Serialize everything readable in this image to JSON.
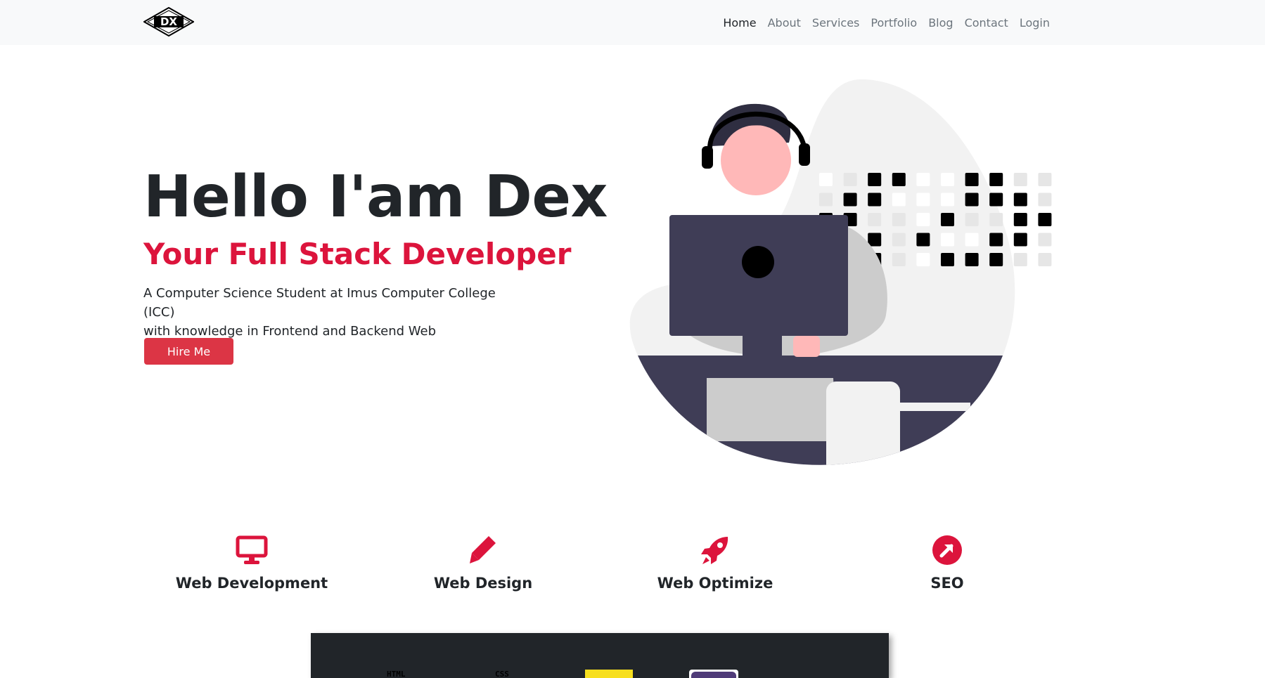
{
  "brand": {
    "logo_text": "DX"
  },
  "nav": {
    "items": [
      {
        "label": "Home",
        "active": true
      },
      {
        "label": "About"
      },
      {
        "label": "Services"
      },
      {
        "label": "Portfolio"
      },
      {
        "label": "Blog"
      },
      {
        "label": "Contact"
      },
      {
        "label": "Login"
      }
    ]
  },
  "hero": {
    "title": "Hello I'am Dex",
    "subtitle": "Your Full Stack Developer",
    "description_line1": "A Computer Science Student at Imus Computer College (ICC)",
    "description_line2": "with knowledge in Frontend and Backend Web Development",
    "cta_label": "Hire Me"
  },
  "services": [
    {
      "label": "Web Development",
      "icon": "monitor-icon"
    },
    {
      "label": "Web Design",
      "icon": "pencil-icon"
    },
    {
      "label": "Web Optimize",
      "icon": "rocket-icon"
    },
    {
      "label": "SEO",
      "icon": "arrow-circle-icon"
    }
  ],
  "skills": {
    "items": [
      {
        "label": "HTML"
      },
      {
        "label": "CSS"
      }
    ]
  },
  "colors": {
    "accent": "#dc143c",
    "button": "#dc3545",
    "navbar_bg": "#f8f9fa",
    "dark": "#212529",
    "illustration_dark": "#3f3d56"
  }
}
